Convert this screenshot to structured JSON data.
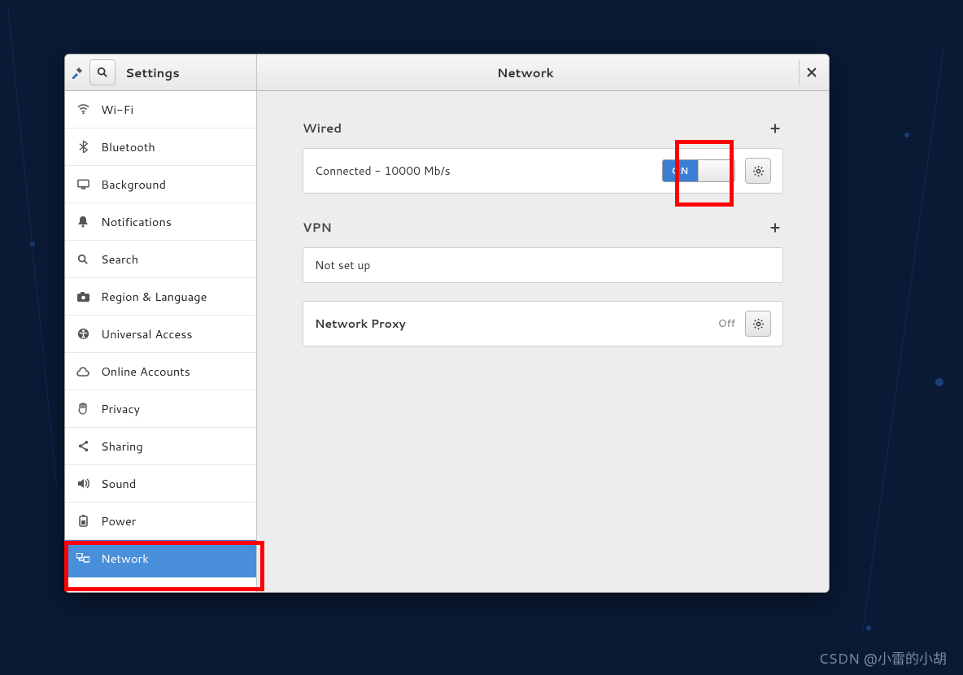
{
  "header": {
    "app_title": "Settings",
    "page_title": "Network"
  },
  "sidebar": {
    "items": [
      {
        "label": "Wi-Fi",
        "icon": "wifi"
      },
      {
        "label": "Bluetooth",
        "icon": "bluetooth"
      },
      {
        "label": "Background",
        "icon": "display"
      },
      {
        "label": "Notifications",
        "icon": "bell"
      },
      {
        "label": "Search",
        "icon": "search"
      },
      {
        "label": "Region & Language",
        "icon": "globe"
      },
      {
        "label": "Universal Access",
        "icon": "accessibility"
      },
      {
        "label": "Online Accounts",
        "icon": "cloud"
      },
      {
        "label": "Privacy",
        "icon": "lock"
      },
      {
        "label": "Sharing",
        "icon": "share"
      },
      {
        "label": "Sound",
        "icon": "sound"
      },
      {
        "label": "Power",
        "icon": "power"
      },
      {
        "label": "Network",
        "icon": "net",
        "selected": true
      }
    ]
  },
  "network": {
    "wired_heading": "Wired",
    "wired_status": "Connected - 10000 Mb/s",
    "wired_switch": "ON",
    "vpn_heading": "VPN",
    "vpn_status": "Not set up",
    "proxy_label": "Network Proxy",
    "proxy_state": "Off"
  },
  "watermark": "CSDN @小雷的小胡"
}
